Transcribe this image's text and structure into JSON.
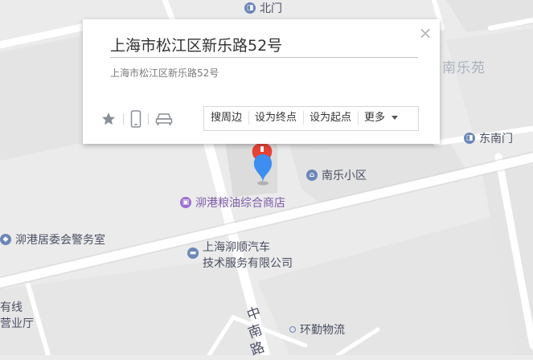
{
  "info_window": {
    "title": "上海市松江区新乐路52号",
    "address": "上海市松江区新乐路52号",
    "close_symbol": "×",
    "icons": [
      "star-icon",
      "phone-icon",
      "car-icon"
    ],
    "actions": {
      "search_nearby": "搜周边",
      "set_destination": "设为终点",
      "set_origin": "设为起点",
      "more": "更多"
    }
  },
  "map": {
    "pois": {
      "north_gate": "北门",
      "nanle_garden": "南乐苑",
      "east_south_gate": "东南门",
      "nanle_community": "南乐小区",
      "grain_oil_store": "泖港粮油综合商店",
      "police_room": "泖港居委会警务室",
      "auto_service_line1": "上海泖顺汽车",
      "auto_service_line2": "技术服务有限公司",
      "business_hall_line1": "有线",
      "business_hall_line2": "营业厅",
      "logistics": "环勤物流"
    },
    "road_label_zhongnan": [
      "中",
      "南",
      "路"
    ],
    "colors": {
      "background": "#ebebeb",
      "road": "#ffffff",
      "block": "#e2e2e2",
      "marker_blue": "#3d8ef0",
      "marker_red": "#e64235",
      "poi_purple": "#9b6fd0",
      "poi_blue": "#6b86b8"
    }
  }
}
